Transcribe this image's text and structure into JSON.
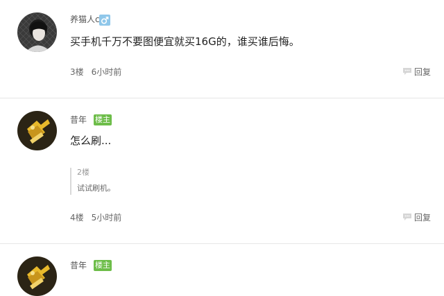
{
  "posts": [
    {
      "username": "养猫人c",
      "gender_icon": "male-icon",
      "content": "买手机千万不要图便宜就买16G的，谁买谁后悔。",
      "floor": "3楼",
      "time": "6小时前",
      "reply_label": "回复"
    },
    {
      "username": "昔年",
      "badge": "楼主",
      "content": "怎么刷...",
      "quote": {
        "floor": "2楼",
        "text": "试试刷机。"
      },
      "floor": "4楼",
      "time": "5小时前",
      "reply_label": "回复"
    },
    {
      "username": "昔年",
      "badge": "楼主"
    }
  ],
  "colors": {
    "badge": "#6dbd49",
    "gender": "#8fc7ea",
    "divider": "#e6e6e6"
  }
}
